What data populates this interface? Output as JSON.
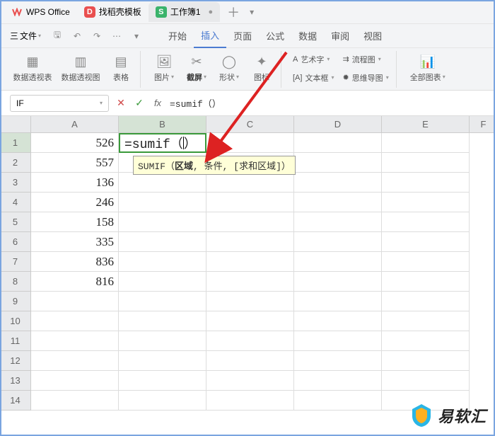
{
  "titlebar": {
    "app_name": "WPS Office",
    "tabs": [
      {
        "icon": "D",
        "label": "找稻壳模板"
      },
      {
        "icon": "S",
        "label": "工作簿1",
        "active": true
      }
    ]
  },
  "menubar": {
    "file_prefix": "三",
    "file_label": "文件",
    "tabs": [
      "开始",
      "插入",
      "页面",
      "公式",
      "数据",
      "审阅",
      "视图"
    ],
    "active_tab": "插入"
  },
  "ribbon": {
    "pivot_table": "数据透视表",
    "pivot_chart": "数据透视图",
    "table": "表格",
    "picture": "图片",
    "screenshot": "截屏",
    "shape": "形状",
    "icon": "图标",
    "wordart": "艺术字",
    "textbox": "文本框",
    "flowchart": "流程图",
    "mindmap": "思维导图",
    "allcharts": "全部图表"
  },
  "formulabar": {
    "name": "IF",
    "formula": "=sumif（）"
  },
  "columns": [
    "A",
    "B",
    "C",
    "D",
    "E",
    "F"
  ],
  "rows": [
    "1",
    "2",
    "3",
    "4",
    "5",
    "6",
    "7",
    "8",
    "9",
    "10",
    "11",
    "12",
    "13",
    "14"
  ],
  "cell_data": {
    "A": [
      "526",
      "557",
      "136",
      "246",
      "158",
      "335",
      "836",
      "816"
    ],
    "B1_edit": "=sumif（",
    "B1_edit_after": "）"
  },
  "tooltip": {
    "fn": "SUMIF",
    "open": "（",
    "arg1": "区域",
    "sep1": ", ",
    "arg2": "条件, ",
    "arg3": "[求和区域]",
    "close": "）"
  },
  "active_cell": {
    "col": "B",
    "row": "1"
  },
  "watermark": "易软汇"
}
